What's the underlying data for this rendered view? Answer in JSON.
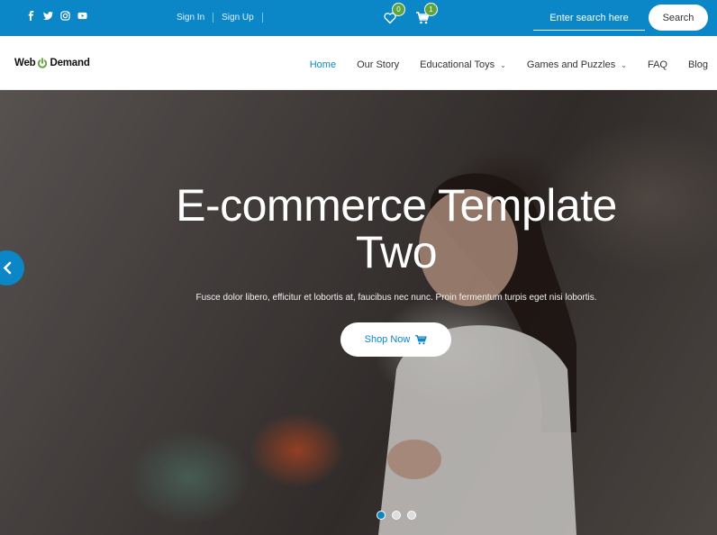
{
  "topbar": {
    "social_icons": [
      "facebook-icon",
      "twitter-icon",
      "instagram-icon",
      "youtube-icon"
    ],
    "sign_in": "Sign In",
    "sign_up": "Sign Up",
    "wishlist_count": "0",
    "cart_count": "1",
    "search_placeholder": "Enter search here",
    "search_button": "Search",
    "color": "#0b86c6"
  },
  "nav": {
    "logo_left": "Web",
    "logo_right": "Demand",
    "items": [
      {
        "label": "Home",
        "active": true
      },
      {
        "label": "Our Story"
      },
      {
        "label": "Educational Toys",
        "dropdown": true
      },
      {
        "label": "Games and Puzzles",
        "dropdown": true
      },
      {
        "label": "FAQ"
      },
      {
        "label": "Blog"
      }
    ]
  },
  "hero": {
    "title_line1": "E-commerce Template",
    "title_line2": "Two",
    "subtitle": "Fusce dolor libero, efficitur et lobortis at, faucibus nec nunc. Proin fermentum turpis eget nisi lobortis.",
    "button": "Shop Now",
    "slides_count": 3,
    "active_slide": 1
  }
}
